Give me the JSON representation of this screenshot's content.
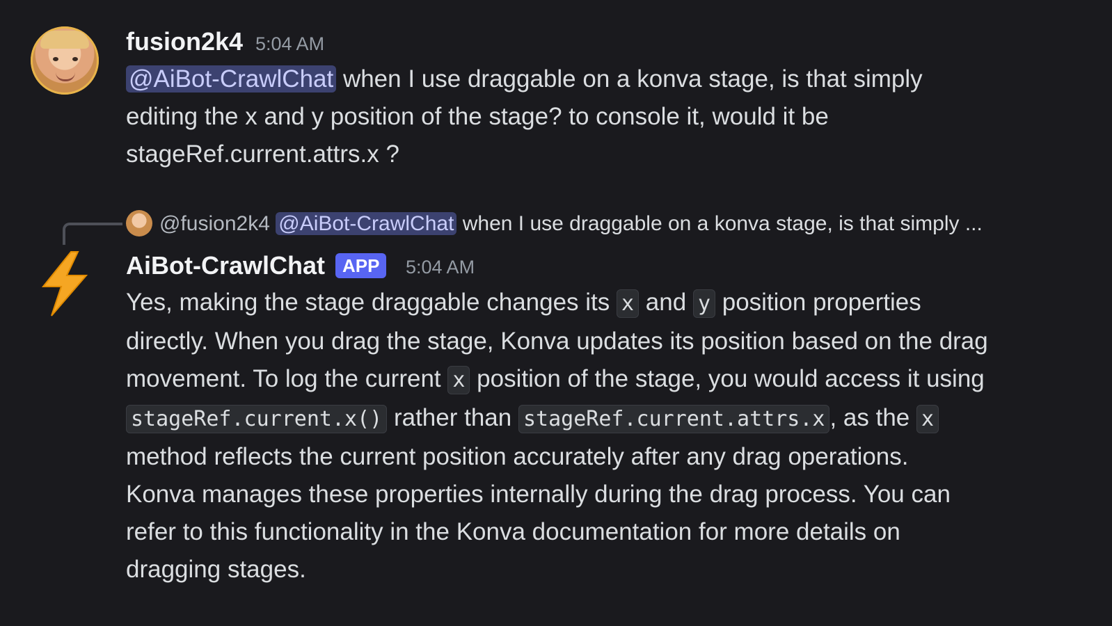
{
  "message1": {
    "username": "fusion2k4",
    "timestamp": "5:04 AM",
    "mention": "@AiBot-CrawlChat",
    "text_line1": " when I use draggable on a konva stage, is that simply",
    "text_line2": "editing the x and y position of the stage? to console it, would it be",
    "text_line3": "stageRef.current.attrs.x ?"
  },
  "reply": {
    "user": "@fusion2k4",
    "mention": "@AiBot-CrawlChat",
    "preview": " when I use draggable on a konva stage, is that simply ..."
  },
  "message2": {
    "username": "AiBot-CrawlChat",
    "badge": "APP",
    "timestamp": "5:04 AM",
    "p1a": "Yes, making the stage draggable changes its ",
    "code_x": "x",
    "p1b": " and ",
    "code_y": "y",
    "p1c": " position properties",
    "line2": "directly. When you drag the stage, Konva updates its position based on the drag",
    "line3a": "movement. To log the current ",
    "line3b": " position of the stage, you would access it using",
    "code_method": "stageRef.current.x()",
    "line4a": " rather than ",
    "code_attrs": "stageRef.current.attrs.x",
    "line4b": ", as the ",
    "line5": "method reflects the current position accurately after any drag operations.",
    "line6": "Konva manages these properties internally during the drag process. You can",
    "line7": "refer to this functionality in the Konva documentation for more details on",
    "line8": "dragging stages."
  },
  "icons": {
    "bot_avatar": "lightning-bolt-icon",
    "reply_connector": "reply-connector-icon"
  },
  "colors": {
    "background": "#1a1a1e",
    "mention_bg": "#3c4270",
    "mention_text": "#c9cdfb",
    "app_badge": "#5865f2",
    "bolt": "#f5a623"
  }
}
